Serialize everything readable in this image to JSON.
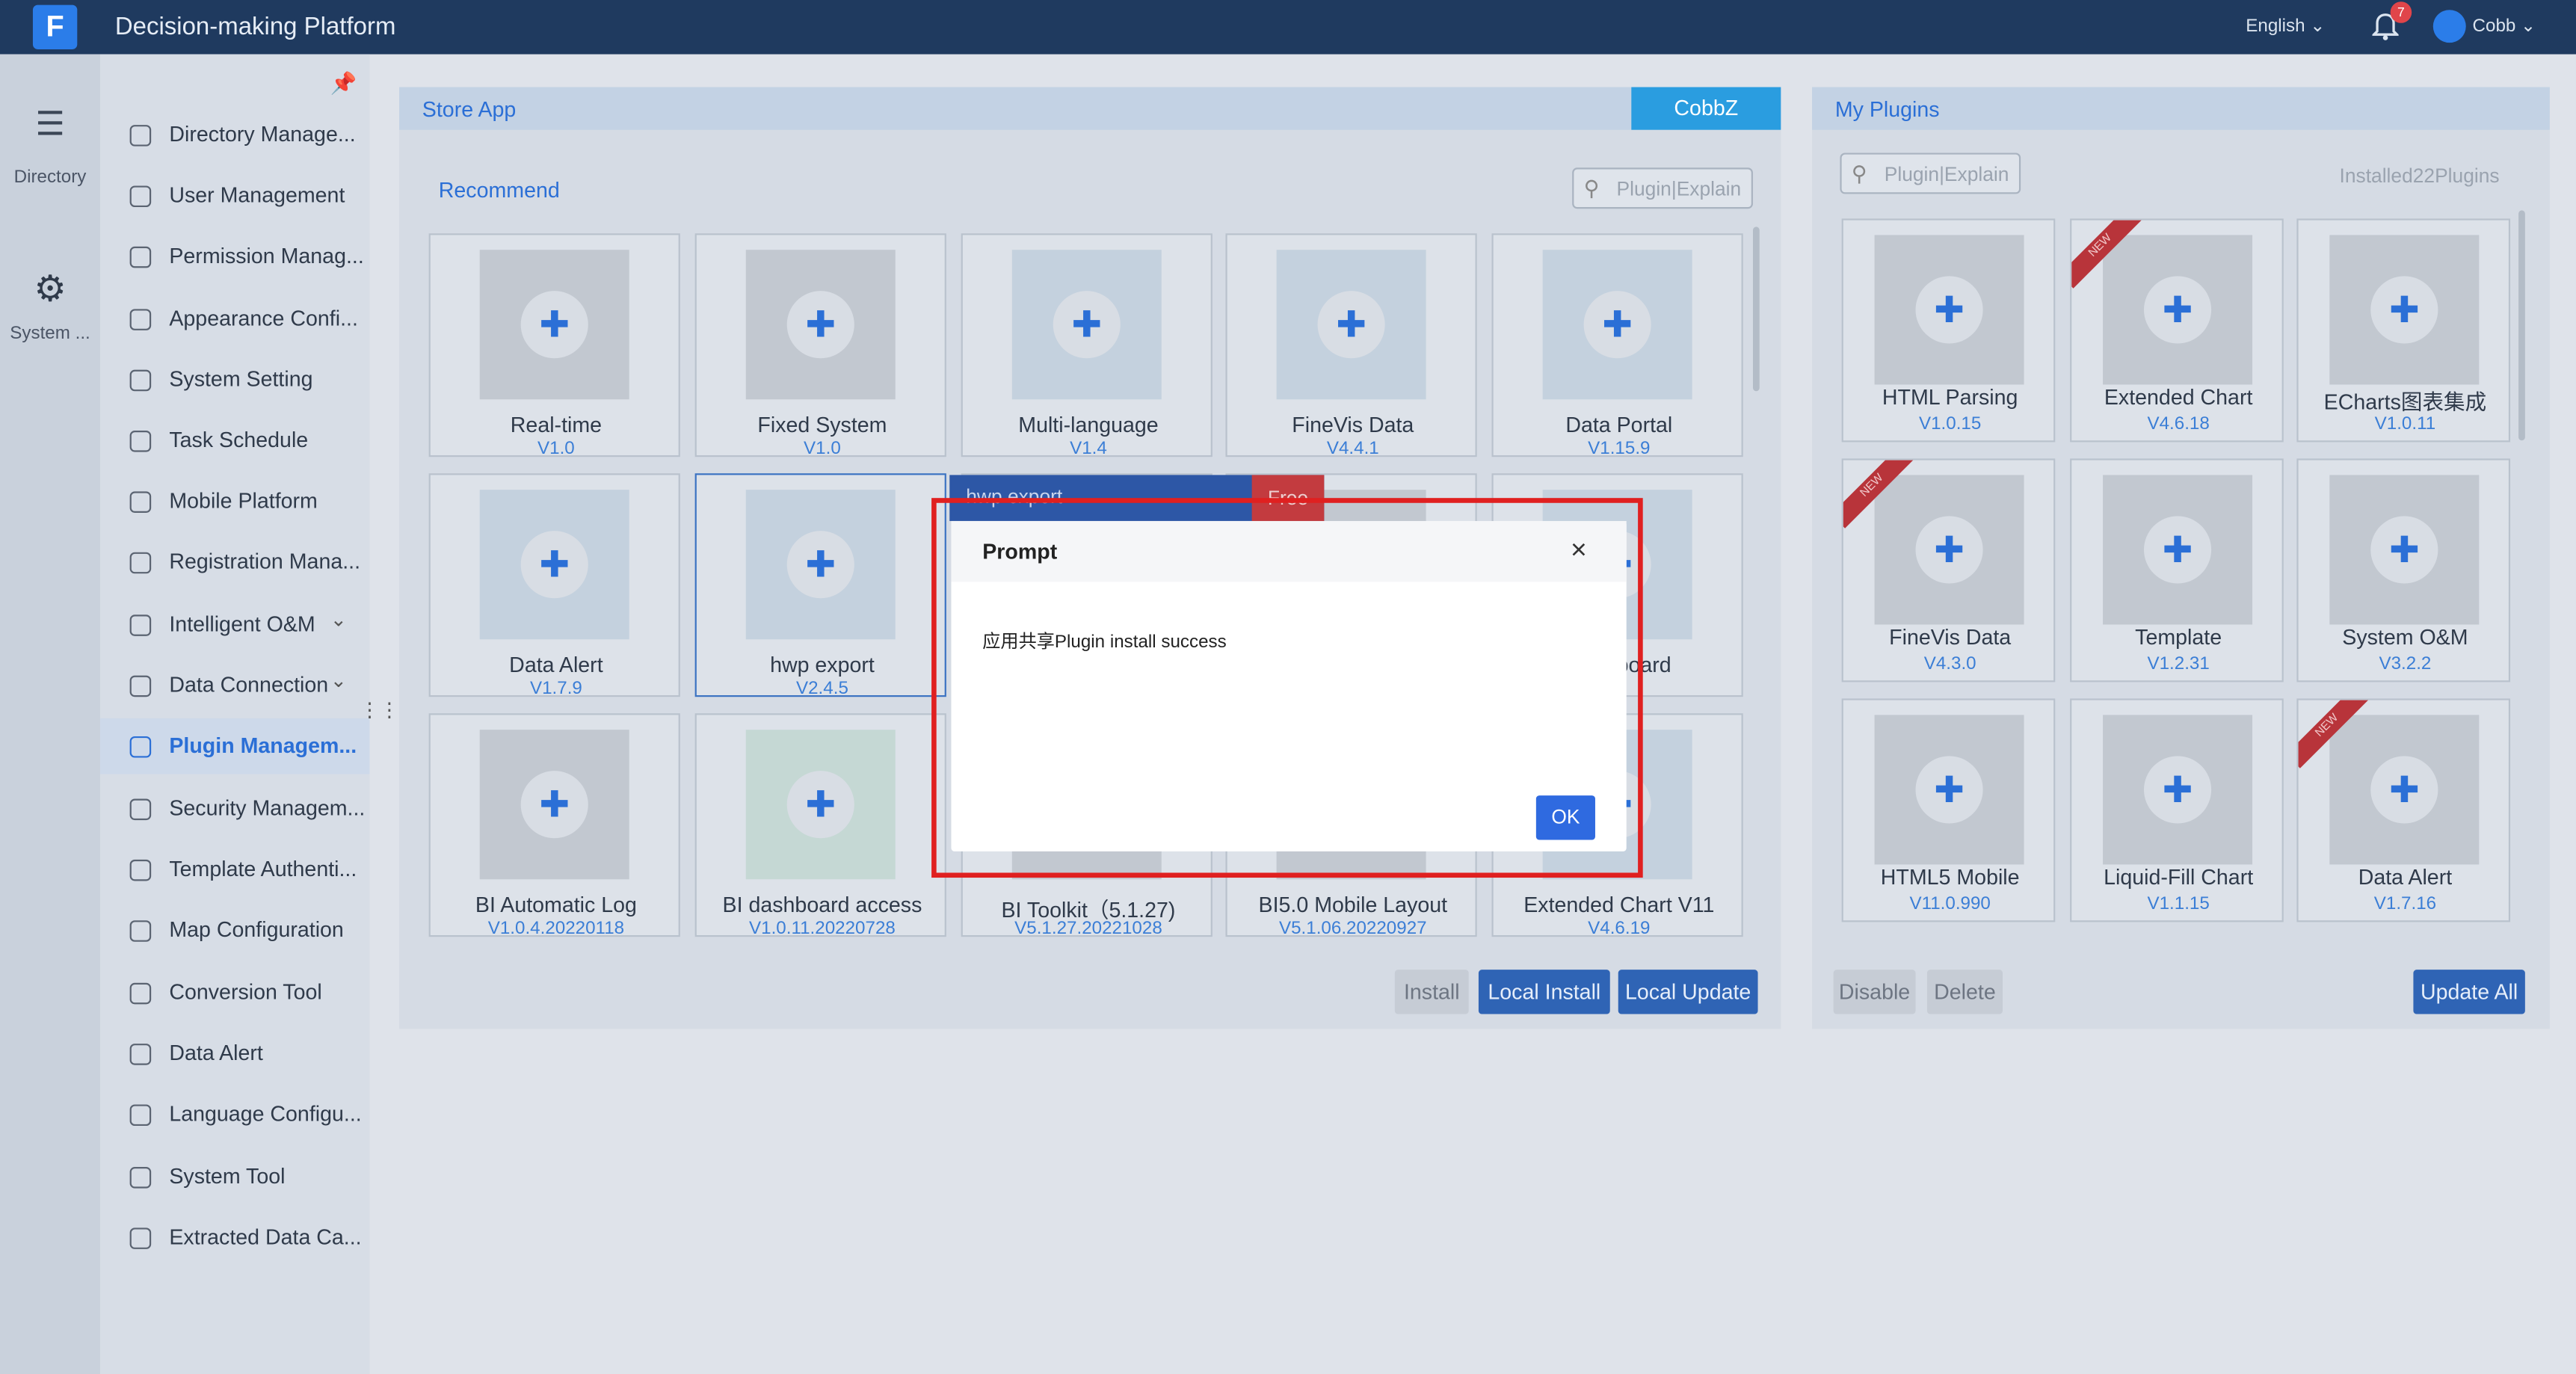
{
  "app": {
    "title": "Decision-making Platform",
    "logo": "F",
    "language": "English",
    "notification_count": "7",
    "user": "Cobb"
  },
  "rail": [
    {
      "icon": "list-icon",
      "label": "Directory"
    },
    {
      "icon": "gear-icon",
      "label": "System ..."
    }
  ],
  "sidebar": {
    "items": [
      {
        "label": "Directory Manage...",
        "icon": "directory-icon"
      },
      {
        "label": "User Management",
        "icon": "user-icon"
      },
      {
        "label": "Permission Manag...",
        "icon": "shield-icon"
      },
      {
        "label": "Appearance Confi...",
        "icon": "brush-icon"
      },
      {
        "label": "System Setting",
        "icon": "gear-icon"
      },
      {
        "label": "Task Schedule",
        "icon": "clock-icon"
      },
      {
        "label": "Mobile Platform",
        "icon": "mobile-icon"
      },
      {
        "label": "Registration Mana...",
        "icon": "register-icon"
      },
      {
        "label": "Intelligent O&M",
        "icon": "om-icon",
        "expandable": true
      },
      {
        "label": "Data Connection",
        "icon": "link-icon",
        "expandable": true
      },
      {
        "label": "Plugin Managem...",
        "icon": "plugin-icon",
        "active": true
      },
      {
        "label": "Security Managem...",
        "icon": "security-icon"
      },
      {
        "label": "Template Authenti...",
        "icon": "template-icon"
      },
      {
        "label": "Map Configuration",
        "icon": "map-icon"
      },
      {
        "label": "Conversion Tool",
        "icon": "conversion-icon"
      },
      {
        "label": "Data Alert",
        "icon": "bell-icon"
      },
      {
        "label": "Language Configu...",
        "icon": "globe-icon"
      },
      {
        "label": "System Tool",
        "icon": "tool-icon"
      },
      {
        "label": "Extracted Data Ca...",
        "icon": "gear-icon"
      }
    ]
  },
  "store": {
    "title": "Store App",
    "account": "CobbZ",
    "recommend": "Recommend",
    "search_placeholder": "Plugin|Explain",
    "cards": [
      {
        "name": "Real-time",
        "version": "V1.0",
        "thumb": "grey"
      },
      {
        "name": "Fixed System",
        "version": "V1.0",
        "thumb": "grey"
      },
      {
        "name": "Multi-language",
        "version": "V1.4",
        "thumb": "blue"
      },
      {
        "name": "FineVis Data",
        "version": "V4.4.1",
        "thumb": "blue"
      },
      {
        "name": "Data Portal",
        "version": "V1.15.9",
        "thumb": "blue"
      },
      {
        "name": "Data Alert",
        "version": "V1.7.9",
        "thumb": "blue"
      },
      {
        "name": "hwp export",
        "version": "V2.4.5",
        "thumb": "blue",
        "selected": true
      },
      {
        "name": "",
        "version": "",
        "thumb": "grey"
      },
      {
        "name": "",
        "version": "",
        "thumb": "grey"
      },
      {
        "name": "Dashboard",
        "version": "",
        "thumb": "blue"
      },
      {
        "name": "BI Automatic Log",
        "version": "V1.0.4.20220118",
        "thumb": "grey"
      },
      {
        "name": "BI dashboard access",
        "version": "V1.0.11.20220728",
        "thumb": "green"
      },
      {
        "name": "BI Toolkit（5.1.27)",
        "version": "V5.1.27.20221028",
        "thumb": "grey"
      },
      {
        "name": "BI5.0 Mobile Layout",
        "version": "V5.1.06.20220927",
        "thumb": "grey"
      },
      {
        "name": "Extended Chart V11",
        "version": "V4.6.19",
        "thumb": "blue"
      }
    ],
    "hover": {
      "name": "hwp export",
      "tag": "Free"
    },
    "buttons": {
      "install": "Install",
      "local_install": "Local Install",
      "local_update": "Local Update"
    }
  },
  "plugins": {
    "title": "My Plugins",
    "search_placeholder": "Plugin|Explain",
    "installed": "Installed22Plugins",
    "cards": [
      {
        "name": "HTML Parsing",
        "version": "V1.0.15",
        "new": false
      },
      {
        "name": "Extended Chart",
        "version": "V4.6.18",
        "new": true
      },
      {
        "name": "ECharts图表集成",
        "version": "V1.0.11",
        "new": false
      },
      {
        "name": "FineVis Data",
        "version": "V4.3.0",
        "new": true
      },
      {
        "name": "Template",
        "version": "V1.2.31",
        "new": false
      },
      {
        "name": "System O&M",
        "version": "V3.2.2",
        "new": false
      },
      {
        "name": "HTML5 Mobile",
        "version": "V11.0.990",
        "new": false
      },
      {
        "name": "Liquid-Fill Chart",
        "version": "V1.1.15",
        "new": false
      },
      {
        "name": "Data Alert",
        "version": "V1.7.16",
        "new": true
      }
    ],
    "new_label": "NEW",
    "buttons": {
      "disable": "Disable",
      "delete": "Delete",
      "update_all": "Update All"
    }
  },
  "modal": {
    "title": "Prompt",
    "message": "应用共享Plugin install success",
    "ok": "OK",
    "close": "×"
  }
}
